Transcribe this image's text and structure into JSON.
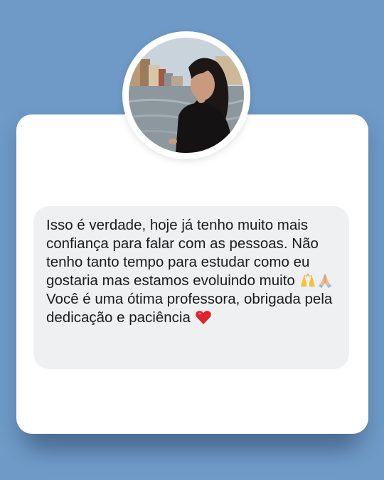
{
  "testimonial": {
    "message_line_1": "Isso é verdade, hoje já tenho muito mais confiança para falar com as pessoas. Não tenho tanto tempo para estudar como eu gostaria mas estamos evoluindo muito",
    "message_line_1_emojis": [
      "raising-hands-icon",
      "folded-hands-icon"
    ],
    "message_line_2": "Você é uma ótima professora, obrigada pela dedicação e paciência",
    "message_line_2_emojis": [
      "red-heart-icon"
    ]
  },
  "colors": {
    "background": "#6f9ac7",
    "card": "#ffffff",
    "bubble": "#eff0f2",
    "text": "#1b1b1b"
  }
}
